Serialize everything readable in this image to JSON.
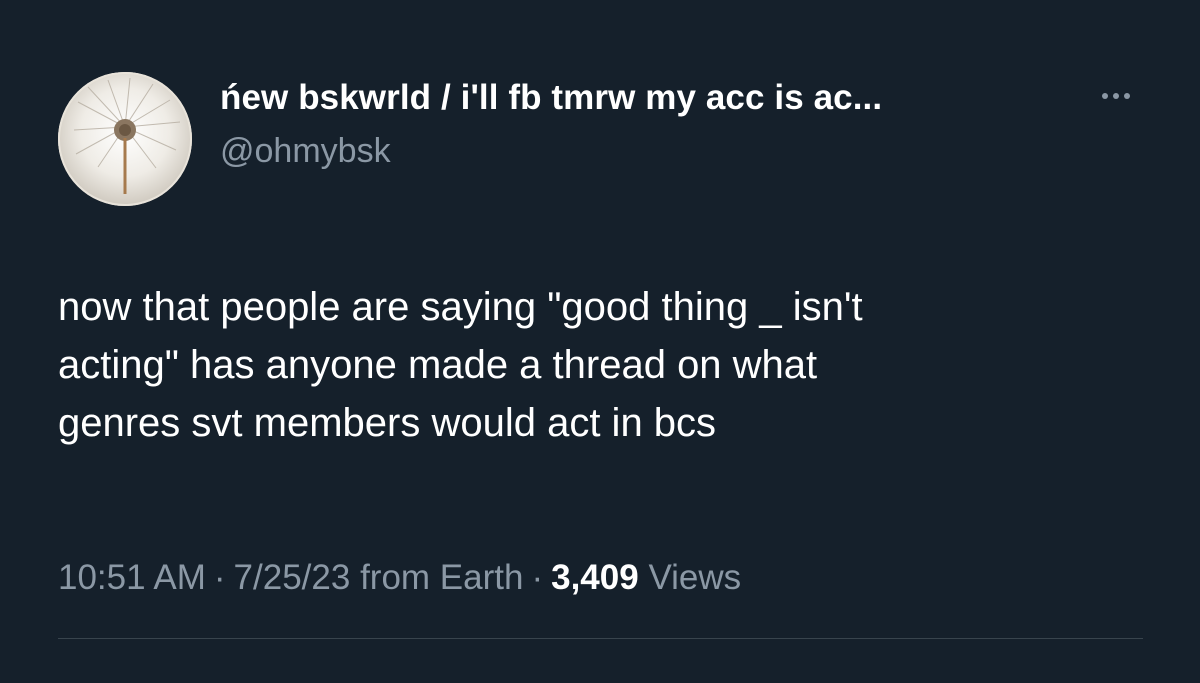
{
  "tweet": {
    "author": {
      "display_name": "ńew bskwrld / i'll fb tmrw my acc is ac...",
      "handle": "@ohmybsk",
      "avatar_icon": "dandelion-photo"
    },
    "more_icon": "more-horizontal-icon",
    "text_lines": [
      "now that people are saying \"good thing _ isn't",
      "acting\" has anyone made a thread on what",
      "genres svt members would act in bcs"
    ],
    "meta": {
      "time": "10:51 AM",
      "separator": "·",
      "date": "7/25/23",
      "source": "from Earth",
      "views_count": "3,409",
      "views_label": "Views"
    }
  },
  "colors": {
    "background": "#15202b",
    "primary_text": "#ffffff",
    "secondary_text": "#8b98a5",
    "divider": "#38444d"
  }
}
